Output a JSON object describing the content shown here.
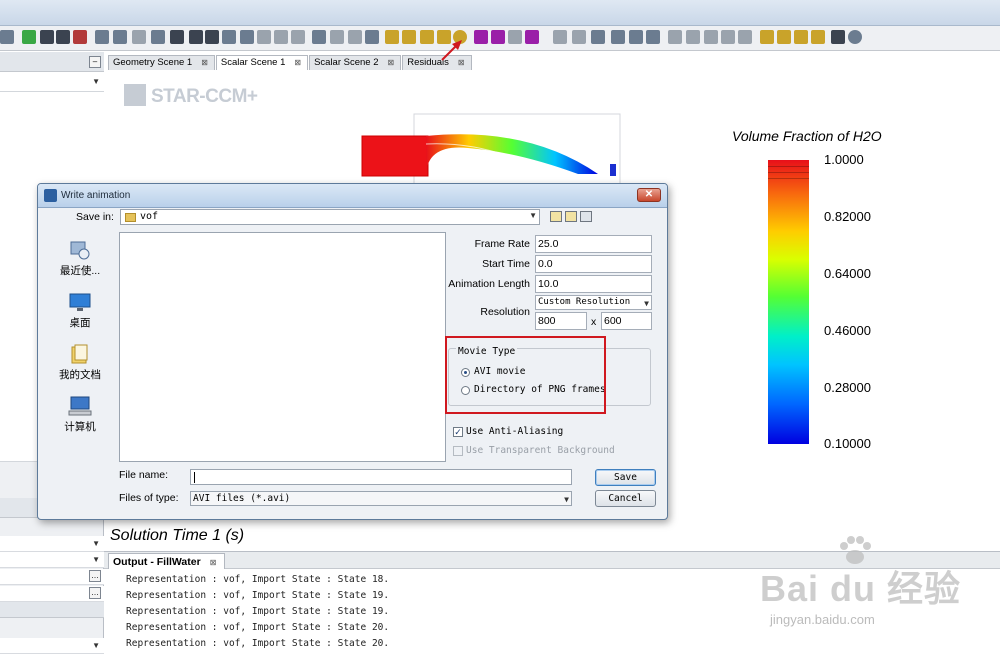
{
  "scene_tabs": [
    {
      "label": "Geometry Scene 1"
    },
    {
      "label": "Scalar Scene 1"
    },
    {
      "label": "Scalar Scene 2"
    },
    {
      "label": "Residuals"
    }
  ],
  "scene": {
    "logo_text": "STAR-CCM+",
    "legend_title": "Volume Fraction of H2O",
    "legend_values": [
      "1.0000",
      "0.82000",
      "0.64000",
      "0.46000",
      "0.28000",
      "0.10000"
    ],
    "solution_time": "Solution Time 1 (s)"
  },
  "output": {
    "tab_label": "Output - FillWater",
    "lines": [
      "Representation : vof, Import State : State 18.",
      "Representation : vof, Import State : State 19.",
      "Representation : vof, Import State : State 19.",
      "Representation : vof, Import State : State 20.",
      "Representation : vof, Import State : State 20."
    ]
  },
  "dialog": {
    "title": "Write animation",
    "save_in_label": "Save in:",
    "save_in_value": "vof",
    "places": [
      "最近使...",
      "桌面",
      "我的文档",
      "计算机"
    ],
    "frame_rate_label": "Frame Rate",
    "frame_rate_value": "25.0",
    "start_time_label": "Start Time",
    "start_time_value": "0.0",
    "anim_length_label": "Animation Length",
    "anim_length_value": "10.0",
    "resolution_label": "Resolution",
    "resolution_mode": "Custom Resolution",
    "res_width": "800",
    "res_x": "x",
    "res_height": "600",
    "movie_type_title": "Movie Type",
    "movie_avi": "AVI movie",
    "movie_png": "Directory of PNG frames",
    "anti_alias_label": "Use Anti-Aliasing",
    "transparent_bg_label": "Use Transparent Background",
    "file_name_label": "File name:",
    "file_name_value": "",
    "files_of_type_label": "Files of type:",
    "files_of_type_value": "AVI files (*.avi)",
    "save_button": "Save",
    "cancel_button": "Cancel"
  },
  "watermark": {
    "text": "Bai du 经验",
    "sub": "jingyan.baidu.com"
  }
}
